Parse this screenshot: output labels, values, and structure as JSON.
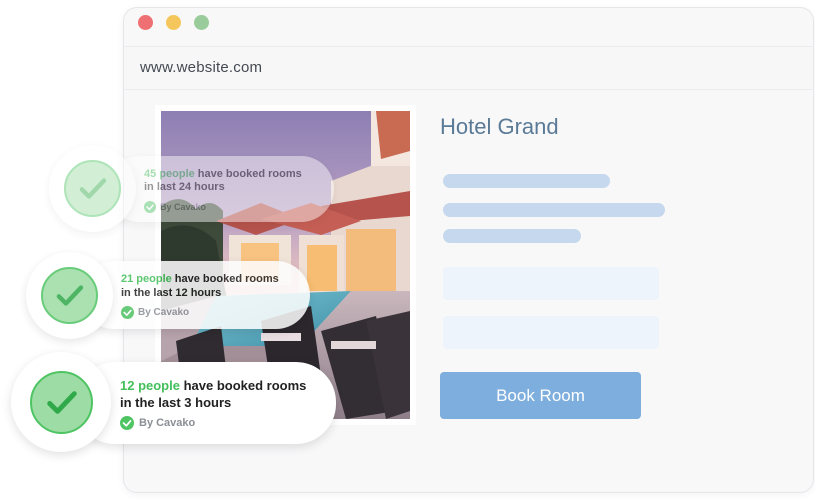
{
  "browser": {
    "url": "www.website.com"
  },
  "hotel": {
    "title": "Hotel Grand",
    "book_label": "Book Room"
  },
  "notifications": [
    {
      "count": "45 people",
      "text": " have booked rooms",
      "line2": "in last 24 hours",
      "by": "By Cavako"
    },
    {
      "count": "21 people",
      "text": " have booked rooms",
      "line2": "in the last 12 hours",
      "by": "By Cavako"
    },
    {
      "count": "12 people",
      "text": " have booked rooms",
      "line2": "in the last 3 hours",
      "by": "By Cavako"
    }
  ],
  "colors": {
    "accent_green": "#43c05a",
    "button_blue": "#7eaedd",
    "title_blue": "#5a7a96"
  },
  "icons": [
    "checkmark-icon",
    "verified-check-icon"
  ]
}
